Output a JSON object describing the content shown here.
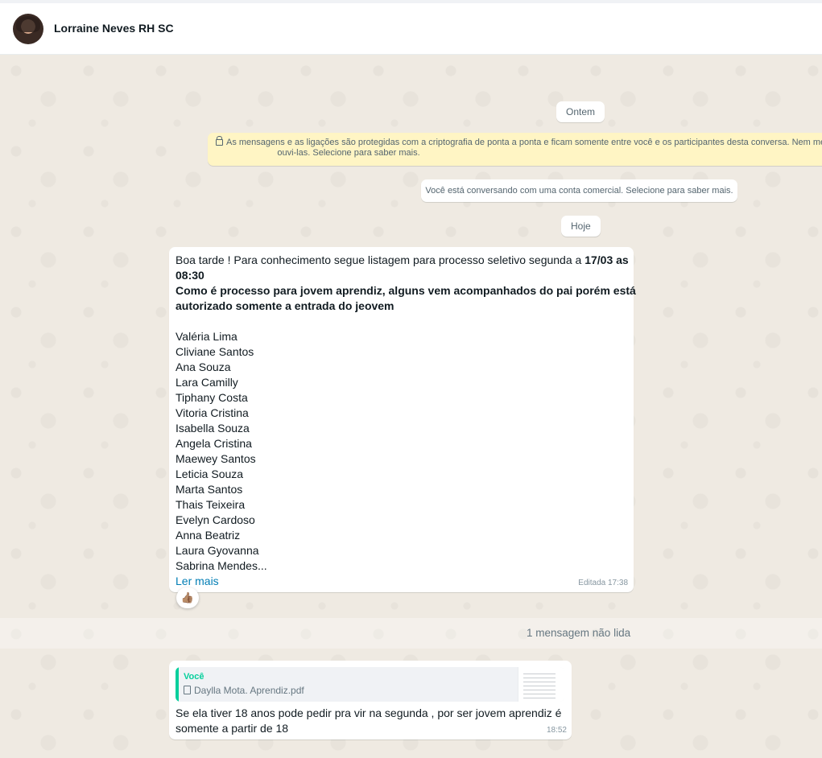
{
  "header": {
    "contact_name": "Lorraine Neves RH SC"
  },
  "chat": {
    "date_yesterday": "Ontem",
    "encryption_notice_line1": "As mensagens e as ligações são protegidas com a criptografia de ponta a ponta e ficam somente entre você e os participantes desta conversa. Nem mesmo o WhatsApp pode ler ou",
    "encryption_notice_line2": "ouvi-las. Selecione para saber mais.",
    "business_notice": "Você está conversando com uma conta comercial. Selecione para saber mais.",
    "date_today": "Hoje",
    "message1": {
      "intro": "Boa tarde ! Para conhecimento segue listagem para processo seletivo segunda a ",
      "intro_bold": "17/03 as",
      "time_line": "08:30",
      "bold_line1": "Como é processo para jovem aprendiz, alguns vem acompanhados do pai porém está",
      "bold_line2": "autorizado somente a entrada do jeovem",
      "names": [
        "Valéria Lima",
        "Cliviane Santos",
        "Ana Souza",
        "Lara Camilly",
        "Tiphany Costa",
        "Vitoria Cristina",
        "Isabella Souza",
        "Angela Cristina",
        "Maewey Santos",
        "Leticia Souza",
        "Marta Santos",
        "Thais Teixeira",
        "Evelyn Cardoso",
        "Anna Beatriz",
        "Laura Gyovanna",
        "Sabrina Mendes..."
      ],
      "read_more": "Ler mais",
      "meta": "Editada 17:38",
      "reaction": "👍🏽"
    },
    "unread_divider": "1 mensagem não lida",
    "message2": {
      "quote_author": "Você",
      "quote_file": "Daylla Mota. Aprendiz.pdf",
      "text": "Se ela tiver 18 anos pode pedir pra vir na segunda , por ser jovem aprendiz é somente a partir de 18",
      "time": "18:52"
    }
  }
}
